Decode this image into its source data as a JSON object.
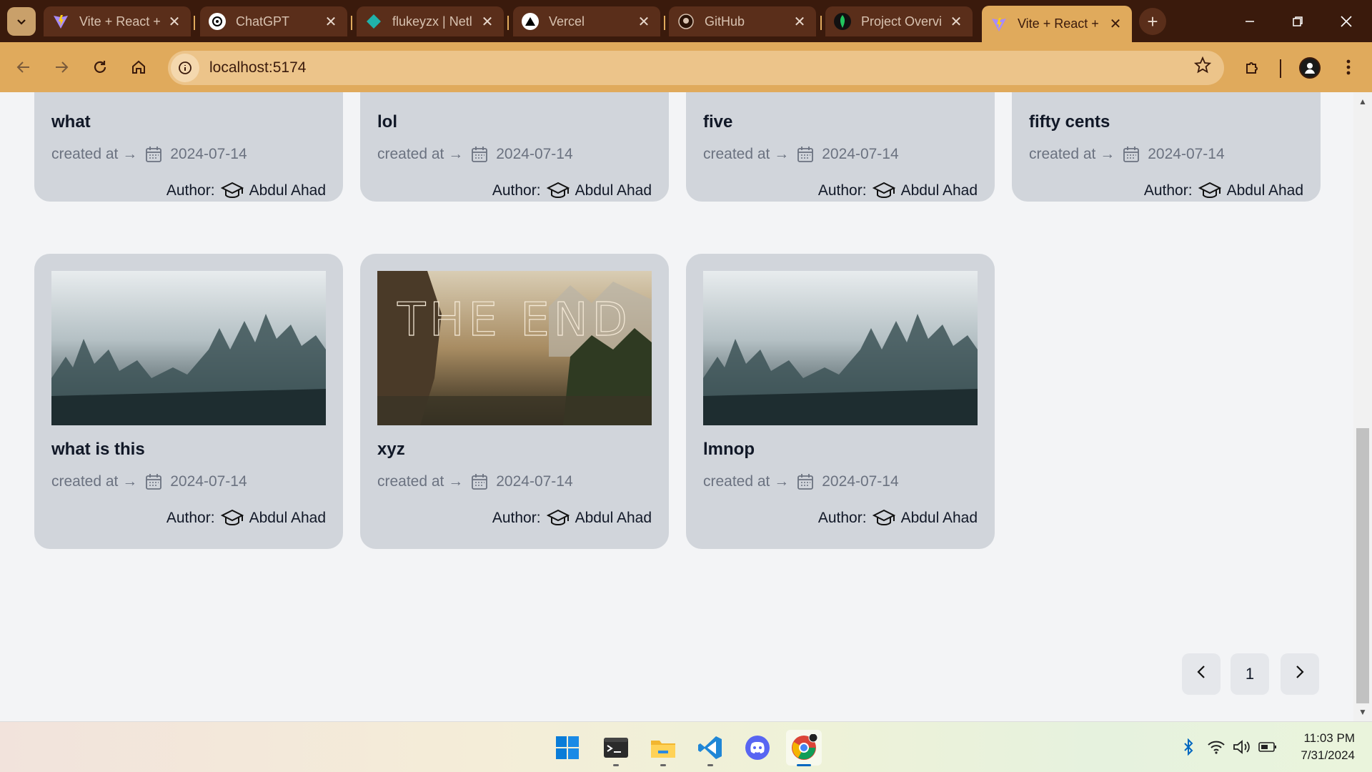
{
  "browser": {
    "tabs": [
      {
        "title": "Vite + React +",
        "icon": "vite-icon",
        "active": false
      },
      {
        "title": "ChatGPT",
        "icon": "chatgpt-icon",
        "active": false
      },
      {
        "title": "flukeyzx | Netl",
        "icon": "netlify-icon",
        "active": false
      },
      {
        "title": "Vercel",
        "icon": "vercel-icon",
        "active": false
      },
      {
        "title": "GitHub",
        "icon": "github-icon",
        "active": false
      },
      {
        "title": "Project Overvi",
        "icon": "mongodb-icon",
        "active": false
      },
      {
        "title": "Vite + React +",
        "icon": "vite-icon",
        "active": true
      }
    ],
    "url": "localhost:5174"
  },
  "cards_row1": [
    {
      "title": "what",
      "created_label": "created at →",
      "date": "2024-07-14",
      "author_label": "Author:",
      "author": "Abdul Ahad"
    },
    {
      "title": "lol",
      "created_label": "created at →",
      "date": "2024-07-14",
      "author_label": "Author:",
      "author": "Abdul Ahad"
    },
    {
      "title": "five",
      "created_label": "created at →",
      "date": "2024-07-14",
      "author_label": "Author:",
      "author": "Abdul Ahad"
    },
    {
      "title": "fifty cents",
      "created_label": "created at →",
      "date": "2024-07-14",
      "author_label": "Author:",
      "author": "Abdul Ahad"
    }
  ],
  "cards_row2": [
    {
      "title": "what is this",
      "created_label": "created at →",
      "date": "2024-07-14",
      "author_label": "Author:",
      "author": "Abdul Ahad",
      "image": "misty-forest"
    },
    {
      "title": "xyz",
      "created_label": "created at →",
      "date": "2024-07-14",
      "author_label": "Author:",
      "author": "Abdul Ahad",
      "image": "the-end-landscape",
      "image_text": "THE END"
    },
    {
      "title": "lmnop",
      "created_label": "created at →",
      "date": "2024-07-14",
      "author_label": "Author:",
      "author": "Abdul Ahad",
      "image": "misty-forest"
    }
  ],
  "pagination": {
    "prev": "‹",
    "current": "1",
    "next": "›"
  },
  "taskbar": {
    "apps": [
      "start-icon",
      "terminal-icon",
      "file-explorer-icon",
      "vscode-icon",
      "discord-icon",
      "chrome-icon"
    ],
    "time": "11:03 PM",
    "date": "7/31/2024"
  },
  "colors": {
    "tab_strip": "#3a1a0c",
    "toolbar": "#e0aa5c",
    "card_bg": "#d1d5db",
    "page_bg": "#f3f4f6"
  }
}
